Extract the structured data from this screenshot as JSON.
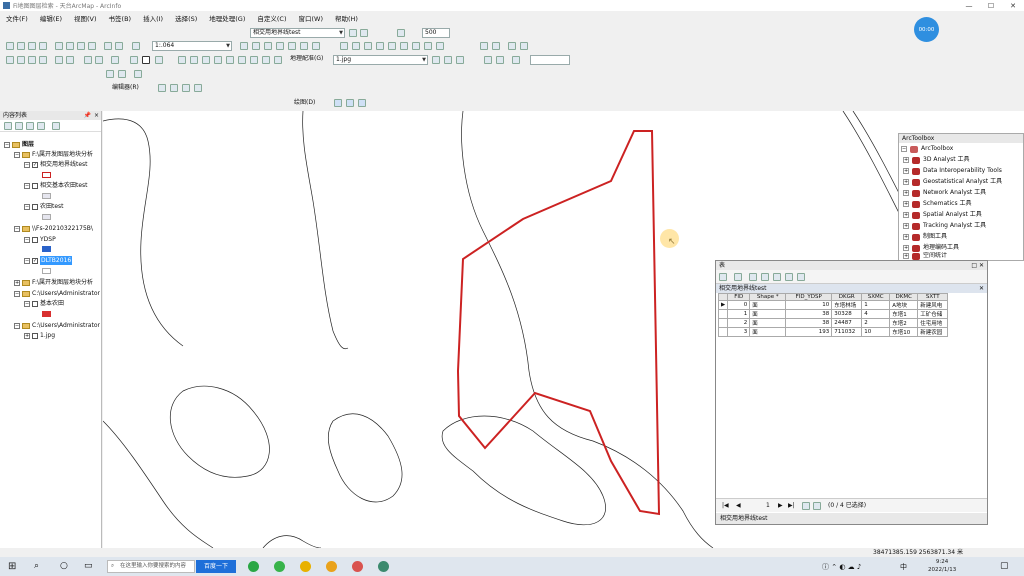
{
  "window": {
    "title": "Fi地图图层检索 - 天台ArcMap - ArcInfo",
    "controls": [
      "—",
      "☐",
      "✕"
    ]
  },
  "menu": [
    "文件(F)",
    "编辑(E)",
    "视图(V)",
    "书签(B)",
    "插入(I)",
    "选择(S)",
    "地理处理(G)",
    "自定义(C)",
    "窗口(W)",
    "帮助(H)"
  ],
  "toolbar": {
    "scale": "1:.064",
    "layer_combo": "相交用地界线test",
    "zoom_value": "500",
    "label_combo": "地理配准(G)",
    "raster_combo": "1.jpg",
    "editor_label": "编辑器(R)",
    "draw_label": "绘图(D)"
  },
  "avatar": {
    "text": "00:00"
  },
  "toc": {
    "title": "内容列表",
    "pin": "📌",
    "close": "×",
    "items": [
      {
        "name": "图层"
      },
      {
        "name": "F:\\属开发图层地块分析"
      },
      {
        "name": "相交用地界线test"
      },
      {
        "name": "相交基本农田test"
      },
      {
        "name": "农田test"
      },
      {
        "name": "\\\\Fs-20210322175B\\"
      },
      {
        "name": "YDSP"
      },
      {
        "name": "DLTB2016"
      },
      {
        "name": "F:\\属开发图层地块分析"
      },
      {
        "name": "C:\\Users\\Administrator"
      },
      {
        "name": "基本农田"
      },
      {
        "name": "C:\\Users\\Administrator"
      },
      {
        "name": "1.jpg"
      }
    ],
    "colors": {
      "red_outline": "#cc2222",
      "blue": "#2a62c9",
      "fill_light": "#e6e6ef",
      "red_fill": "#d83030"
    }
  },
  "arctoolbox": {
    "title": "ArcToolbox",
    "root": "ArcToolbox",
    "items": [
      "3D Analyst 工具",
      "Data Interoperability Tools",
      "Geostatistical Analyst 工具",
      "Network Analyst 工具",
      "Schematics 工具",
      "Spatial Analyst 工具",
      "Tracking Analyst 工具",
      "制图工具",
      "地理编码工具",
      "空间统计"
    ]
  },
  "table": {
    "title": "表",
    "layer": "相交用地界线test",
    "columns": [
      "FID",
      "Shape *",
      "FID_YDSP",
      "DKGR",
      "SXMC",
      "DKMC",
      "SXTT"
    ],
    "rows": [
      [
        "0",
        "面",
        "10",
        "东塔林场",
        "1",
        "A地块",
        "新建风电"
      ],
      [
        "1",
        "面",
        "38",
        "30328",
        "4",
        "东塔1",
        "工矿仓储"
      ],
      [
        "2",
        "面",
        "38",
        "24487",
        "2",
        "东塔2",
        "住宅用地"
      ],
      [
        "3",
        "面",
        "193",
        "711032",
        "10",
        "东塔10",
        "新建农园"
      ]
    ],
    "nav": {
      "record": "1",
      "count": "(0 / 4 已选择)"
    },
    "tab": "相交用地界线test"
  },
  "status": {
    "coords": "38471385.159  2563871.34 米"
  },
  "taskbar": {
    "search_placeholder": "在这里输入你要搜索的内容",
    "search_button": "百度一下",
    "time": "9:24",
    "date": "2022/1/13",
    "ime": "中"
  }
}
